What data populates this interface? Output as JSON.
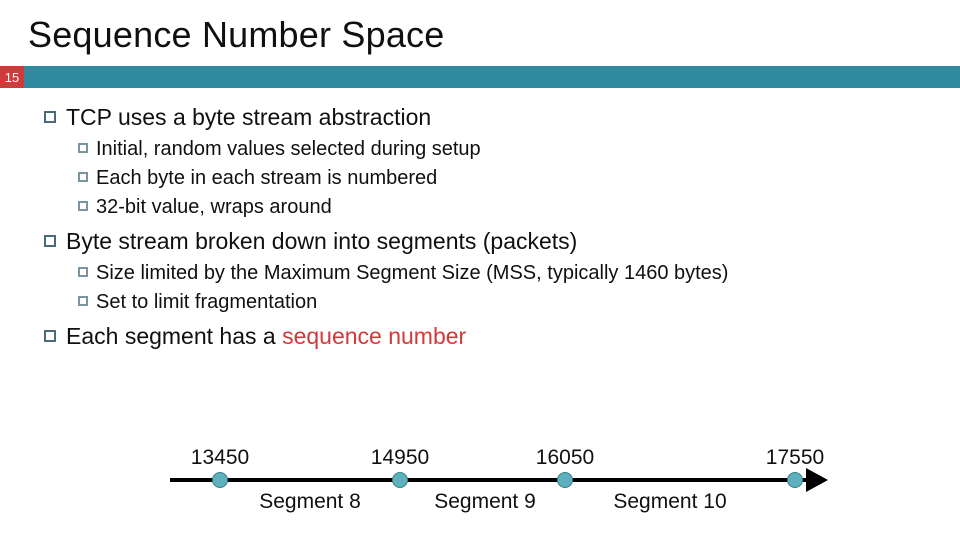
{
  "title": "Sequence Number Space",
  "slide_number": "15",
  "bullets": [
    {
      "text": "TCP uses a byte stream abstraction",
      "subs": [
        "Initial, random values selected during setup",
        "Each byte in each stream is numbered",
        "32-bit value, wraps around"
      ]
    },
    {
      "text": "Byte stream broken down into segments (packets)",
      "subs": [
        "Size limited by the Maximum Segment Size (MSS, typically 1460 bytes)",
        "Set to limit fragmentation"
      ]
    },
    {
      "text_prefix": "Each segment has a ",
      "text_emph": "sequence number",
      "subs": []
    }
  ],
  "diagram": {
    "seq_numbers": [
      "13450",
      "14950",
      "16050",
      "17550"
    ],
    "segments": [
      "Segment 8",
      "Segment 9",
      "Segment 10"
    ]
  }
}
